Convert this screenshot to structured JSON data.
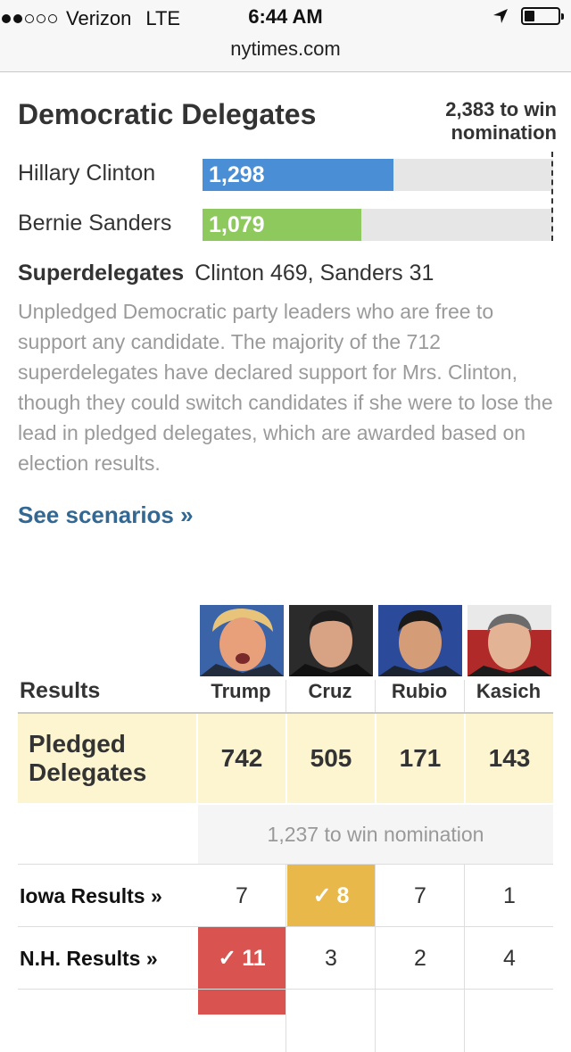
{
  "status_bar": {
    "carrier": "Verizon",
    "network": "LTE",
    "time": "6:44 AM",
    "url": "nytimes.com",
    "signal_bars_filled": 2,
    "signal_bars_total": 5
  },
  "democratic": {
    "title": "Democratic Delegates",
    "win_line1": "2,383 to win",
    "win_line2": "nomination",
    "win_target": 2383,
    "candidates": [
      {
        "name": "Hillary Clinton",
        "value_label": "1,298",
        "value": 1298,
        "color": "#4a8fd6"
      },
      {
        "name": "Bernie Sanders",
        "value_label": "1,079",
        "value": 1079,
        "color": "#8ec95e"
      }
    ],
    "superdelegates_label": "Superdelegates",
    "superdelegates_text": "Clinton 469, Sanders 31",
    "superdelegates_desc": "Unpledged Democratic party leaders who are free to support any candidate. The majority of the 712 superdelegates have declared support for Mrs. Clinton, though they could switch candidates if she were to lose the lead in pledged delegates, which are awarded based on election results.",
    "see_scenarios": "See scenarios »"
  },
  "republican": {
    "results_label": "Results",
    "candidates": [
      "Trump",
      "Cruz",
      "Rubio",
      "Kasich"
    ],
    "pledged_label_line1": "Pledged",
    "pledged_label_line2": "Delegates",
    "pledged_values": [
      "742",
      "505",
      "171",
      "143"
    ],
    "needed_text": "1,237 to win nomination",
    "states": [
      {
        "label": "Iowa Results »",
        "values": [
          "7",
          "8",
          "7",
          "1"
        ],
        "winner_index": 1
      },
      {
        "label": "N.H. Results »",
        "values": [
          "11",
          "3",
          "2",
          "4"
        ],
        "winner_index": 0
      }
    ],
    "colors": {
      "cruz_win": "#e8b84a",
      "trump_win": "#d95350",
      "pledged_bg": "#fcf5cf"
    }
  }
}
